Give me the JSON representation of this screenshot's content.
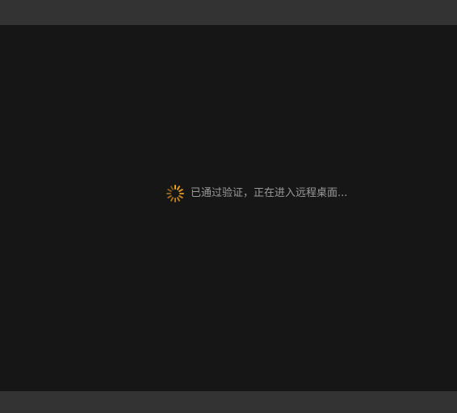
{
  "status": {
    "message": "已通过验证，正在进入远程桌面...",
    "icon": "loading-spinner-icon",
    "accent_color": "#f0a020"
  }
}
